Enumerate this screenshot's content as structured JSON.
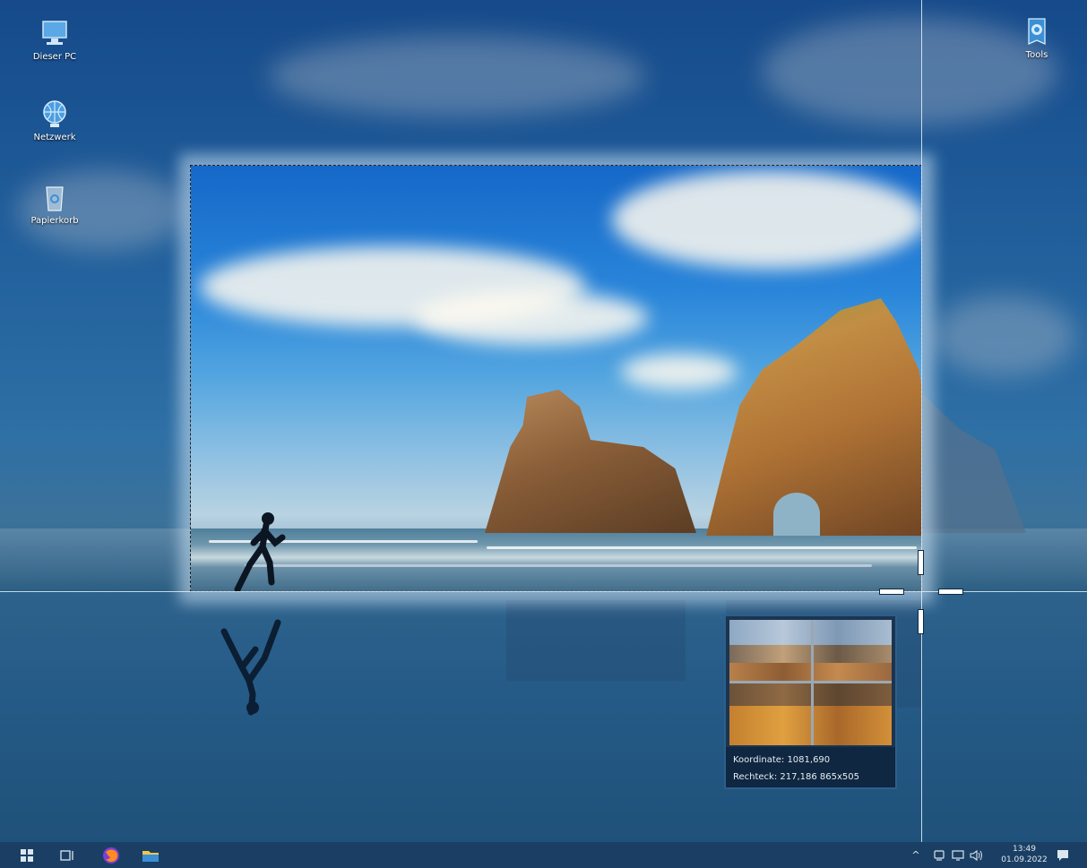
{
  "desktop": {
    "icons": [
      {
        "label": "Dieser PC",
        "icon": "computer-icon"
      },
      {
        "label": "Netzwerk",
        "icon": "network-icon"
      },
      {
        "label": "Papierkorb",
        "icon": "recycle-bin-icon"
      },
      {
        "label": "Tools",
        "icon": "tools-shortcut-icon"
      }
    ]
  },
  "magnifier": {
    "coordinate": "Koordinate: 1081,690",
    "rectangle": "Rechteck: 217,186 865x505"
  },
  "taskbar": {
    "apps": [
      {
        "icon": "windows-start-icon"
      },
      {
        "icon": "task-view-icon"
      },
      {
        "icon": "firefox-icon"
      },
      {
        "icon": "file-explorer-icon"
      }
    ],
    "tray": {
      "chevron": "^",
      "time": "13:49",
      "date": "01.09.2022"
    }
  },
  "colors": {
    "taskbar": "#1b3f64",
    "magnifier_bg": "#1b3550",
    "magnifier_border": "#2c5f8c"
  }
}
